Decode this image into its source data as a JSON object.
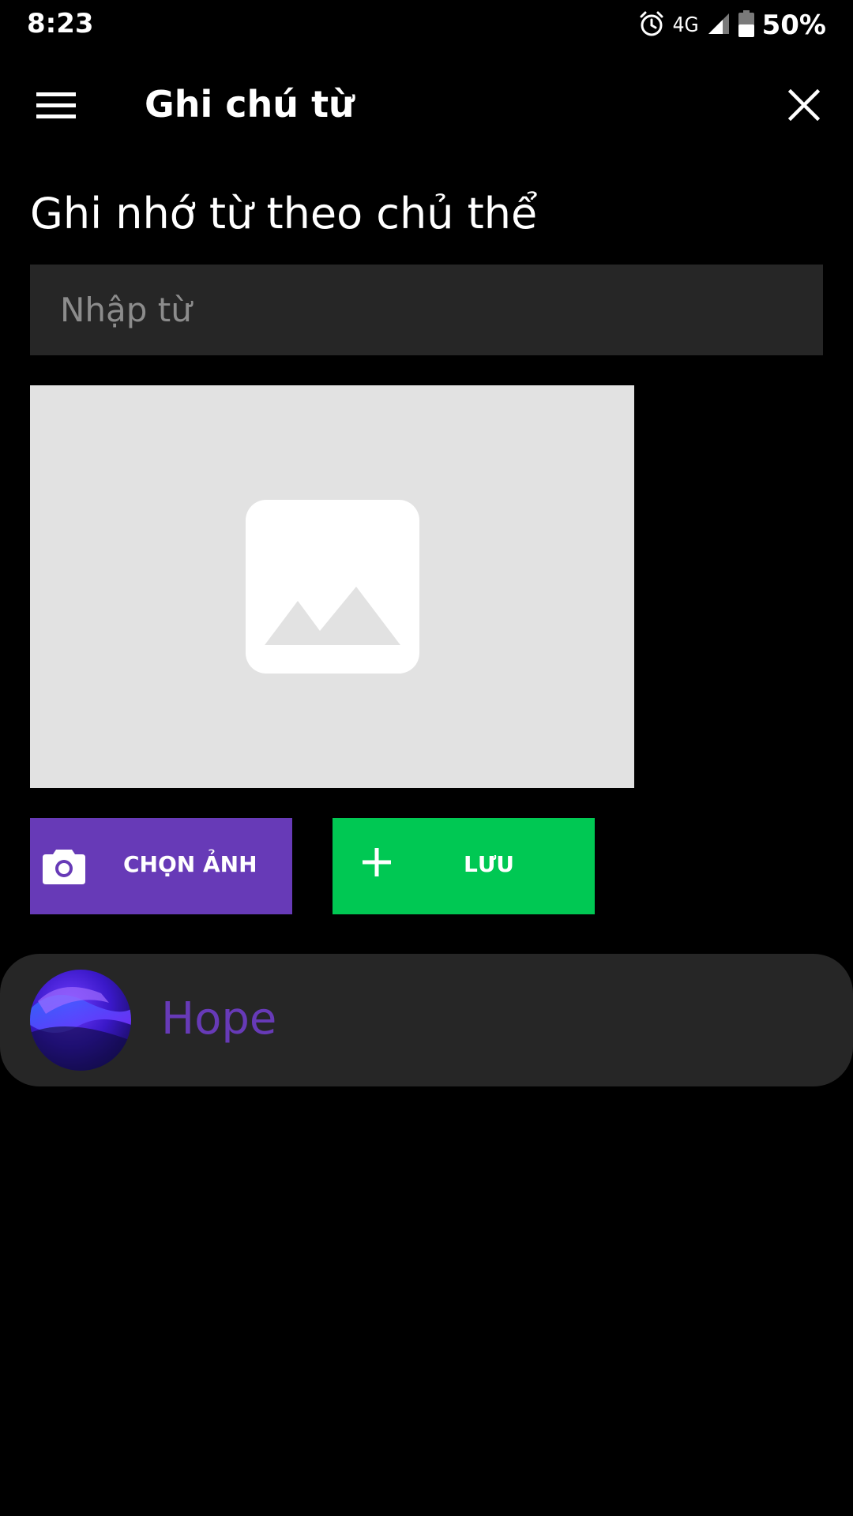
{
  "status_bar": {
    "time": "8:23",
    "network": "4G",
    "battery": "50%"
  },
  "app_bar": {
    "title": "Ghi chú từ"
  },
  "form": {
    "section_title": "Ghi nhớ từ theo chủ thể",
    "word_input": {
      "placeholder": "Nhập từ",
      "value": ""
    },
    "choose_image_label": "CHỌN ẢNH",
    "save_label": "LƯU"
  },
  "items": [
    {
      "label": "Hope"
    }
  ],
  "colors": {
    "background": "#000000",
    "input_bg": "#262626",
    "card_bg": "#262626",
    "accent_purple": "#673ab7",
    "accent_green": "#00c853",
    "image_placeholder_bg": "#e2e2e2"
  },
  "icons": {
    "menu": "hamburger-menu-icon",
    "close": "close-icon",
    "alarm": "alarm-icon",
    "signal": "signal-icon",
    "battery": "battery-icon",
    "image_placeholder": "image-placeholder-icon",
    "camera": "camera-icon",
    "plus": "plus-icon"
  }
}
